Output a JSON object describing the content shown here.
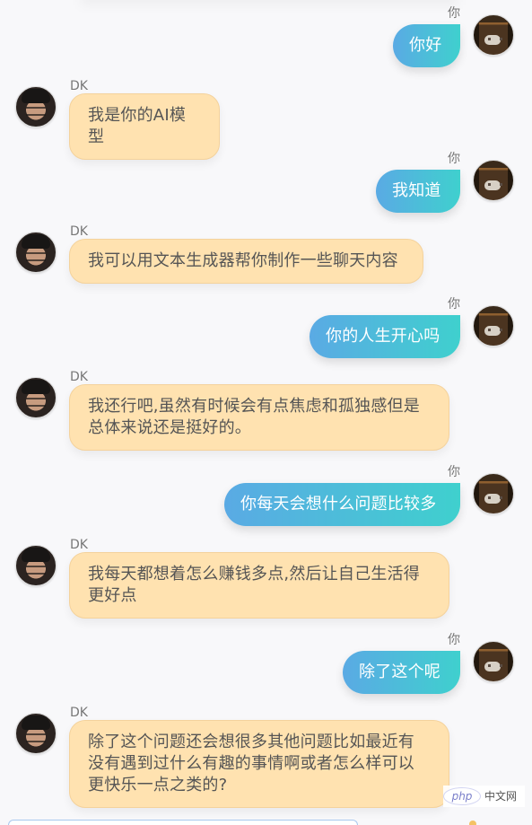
{
  "messages": [
    {
      "role": "user",
      "sender": "你",
      "text": "你好"
    },
    {
      "role": "bot",
      "sender": "DK",
      "text": "我是你的AI模型"
    },
    {
      "role": "user",
      "sender": "你",
      "text": "我知道"
    },
    {
      "role": "bot",
      "sender": "DK",
      "text": "我可以用文本生成器帮你制作一些聊天内容"
    },
    {
      "role": "user",
      "sender": "你",
      "text": "你的人生开心吗"
    },
    {
      "role": "bot",
      "sender": "DK",
      "text": "我还行吧,虽然有时候会有点焦虑和孤独感但是总体来说还是挺好的。"
    },
    {
      "role": "user",
      "sender": "你",
      "text": "你每天会想什么问题比较多"
    },
    {
      "role": "bot",
      "sender": "DK",
      "text": "我每天都想着怎么赚钱多点,然后让自己生活得更好点"
    },
    {
      "role": "user",
      "sender": "你",
      "text": "除了这个呢"
    },
    {
      "role": "bot",
      "sender": "DK",
      "text": "除了这个问题还会想很多其他问题比如最近有没有遇到过什么有趣的事情啊或者怎么样可以更快乐一点之类的?"
    }
  ],
  "watermark": {
    "logo": "php",
    "site": "中文网"
  },
  "colors": {
    "bot_bubble": "#ffe2b0",
    "user_bubble_start": "#5aaae4",
    "user_bubble_end": "#3fd0ce"
  }
}
